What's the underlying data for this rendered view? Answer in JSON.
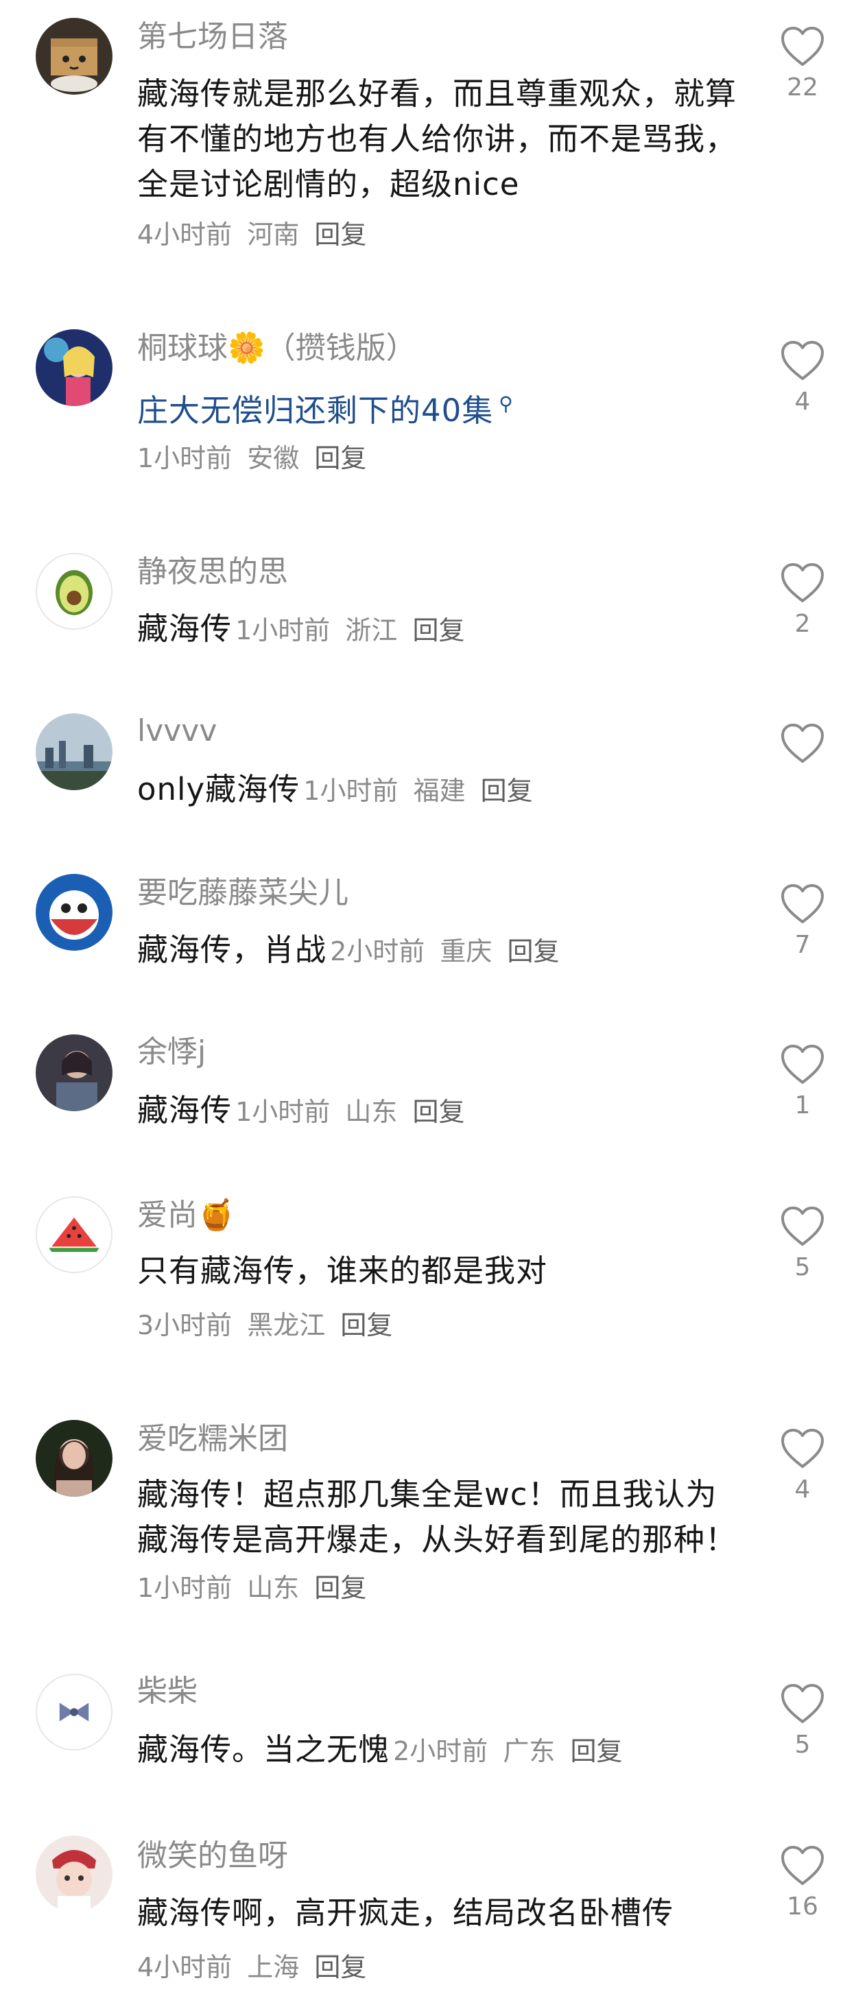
{
  "comments": [
    {
      "user": "第七场日落",
      "text": "藏海传就是那么好看，而且尊重观众，就算有不懂的地方也有人给你讲，而不是骂我，全是讨论剧情的，超级nice",
      "time": "4小时前",
      "location": "河南",
      "reply": "回复",
      "likes": "22",
      "avatar": "cardboard-box-cat-avatar"
    },
    {
      "user": "桐球球",
      "user_emoji": "🌼",
      "user_suffix": "（攒钱版）",
      "text": "庄大无偿归还剩下的40集",
      "time": "1小时前",
      "location": "安徽",
      "reply": "回复",
      "likes": "4",
      "avatar": "anime-girl-avatar"
    },
    {
      "user": "静夜思的思",
      "text": "藏海传",
      "time": "1小时前",
      "location": "浙江",
      "reply": "回复",
      "likes": "2",
      "avatar": "avocado-avatar"
    },
    {
      "user": "lvvvv",
      "text": "only藏海传",
      "time": "1小时前",
      "location": "福建",
      "reply": "回复",
      "likes": "",
      "avatar": "city-skyline-avatar"
    },
    {
      "user": "要吃藤藤菜尖儿",
      "text": "藏海传，肖战",
      "time": "2小时前",
      "location": "重庆",
      "reply": "回复",
      "likes": "7",
      "avatar": "cartoon-avatar"
    },
    {
      "user": "余悸j",
      "text": "藏海传",
      "time": "1小时前",
      "location": "山东",
      "reply": "回复",
      "likes": "1",
      "avatar": "photo-avatar"
    },
    {
      "user": "爱尚",
      "user_emoji": "🍯",
      "text": "只有藏海传，谁来的都是我对",
      "time": "3小时前",
      "location": "黑龙江",
      "reply": "回复",
      "likes": "5",
      "avatar": "watermelon-avatar"
    },
    {
      "user": "爱吃糯米团",
      "text": "藏海传！超点那几集全是wc！而且我认为藏海传是高开爆走，从头好看到尾的那种！",
      "time": "1小时前",
      "location": "山东",
      "reply": "回复",
      "likes": "4",
      "avatar": "portrait-avatar"
    },
    {
      "user": "柴柴",
      "text": "藏海传。当之无愧",
      "time": "2小时前",
      "location": "广东",
      "reply": "回复",
      "likes": "5",
      "avatar": "bow-avatar"
    },
    {
      "user": "微笑的鱼呀",
      "text": "藏海传啊，高开疯走，结局改名卧槽传",
      "time": "4小时前",
      "location": "上海",
      "reply": "回复",
      "likes": "16",
      "avatar": "doll-avatar"
    }
  ],
  "colors": {
    "username": "#8a8a8a",
    "text": "#161616",
    "link": "#1f4e8c",
    "meta": "#8a8a8a"
  }
}
